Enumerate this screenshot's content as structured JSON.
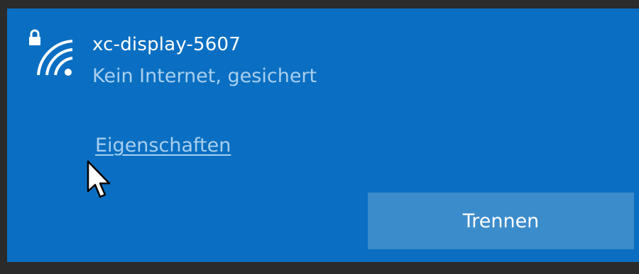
{
  "network": {
    "name": "xc-display-5607",
    "status": "Kein Internet, gesichert",
    "icon": "wifi-secured-icon"
  },
  "actions": {
    "properties_label": "Eigenschaften",
    "disconnect_label": "Trennen"
  },
  "colors": {
    "panel_background": "#0a6fc2",
    "button_background": "#3b8ccb",
    "link_text": "#a9cfee",
    "frame": "#2b2b2b"
  }
}
